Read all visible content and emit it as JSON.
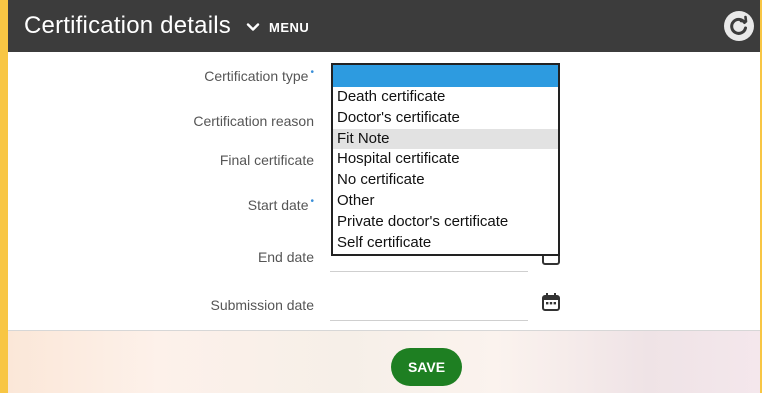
{
  "header": {
    "title": "Certification details",
    "menu_label": "MENU"
  },
  "form": {
    "certification_type_label": "Certification type",
    "certification_reason_label": "Certification reason",
    "final_certificate_label": "Final certificate",
    "start_date_label": "Start date",
    "end_date_label": "End date",
    "submission_date_label": "Submission date",
    "required_marker": "•"
  },
  "dropdown": {
    "selected_value": "",
    "highlighted_option": "Fit Note",
    "options": [
      "Death certificate",
      "Doctor's certificate",
      "Fit Note",
      "Hospital certificate",
      "No certificate",
      "Other",
      "Private doctor's certificate",
      "Self certificate"
    ]
  },
  "footer": {
    "save_label": "SAVE"
  },
  "colors": {
    "border_accent": "#f8c644",
    "header_bg": "#3c3c3c",
    "selected_option_bg": "#2d9be0",
    "highlight_option_bg": "#e2e2e2",
    "save_button_bg": "#1e7f22",
    "required_marker": "#3a8fd8"
  },
  "icons": [
    "chevron-down-icon",
    "refresh-icon",
    "calendar-icon"
  ]
}
